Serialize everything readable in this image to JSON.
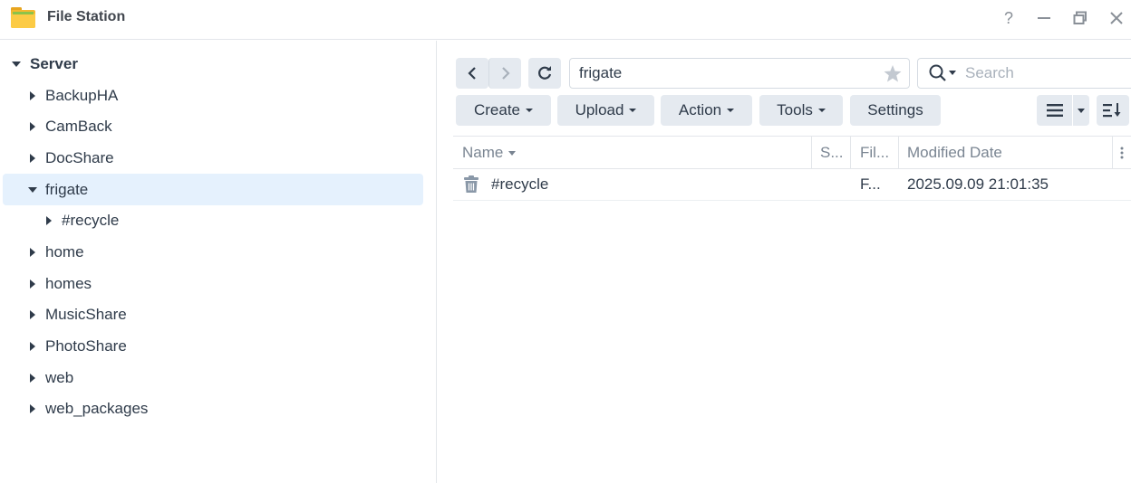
{
  "window": {
    "title": "File Station",
    "controls": {
      "help": "?",
      "minimize": "—",
      "restore": "restore",
      "close": "✕"
    }
  },
  "sidebar": {
    "root": "Server",
    "items": [
      {
        "label": "BackupHA",
        "expanded": false
      },
      {
        "label": "CamBack",
        "expanded": false
      },
      {
        "label": "DocShare",
        "expanded": false
      },
      {
        "label": "frigate",
        "expanded": true,
        "selected": true
      },
      {
        "label": "#recycle",
        "expanded": false,
        "child": true
      },
      {
        "label": "home",
        "expanded": false
      },
      {
        "label": "homes",
        "expanded": false
      },
      {
        "label": "MusicShare",
        "expanded": false
      },
      {
        "label": "PhotoShare",
        "expanded": false
      },
      {
        "label": "web",
        "expanded": false
      },
      {
        "label": "web_packages",
        "expanded": false
      }
    ]
  },
  "toolbar": {
    "path": "frigate",
    "search_placeholder": "Search",
    "buttons": {
      "create": "Create",
      "upload": "Upload",
      "action": "Action",
      "tools": "Tools",
      "settings": "Settings"
    }
  },
  "table": {
    "columns": {
      "name": "Name",
      "size": "S...",
      "type": "Fil...",
      "modified": "Modified Date"
    },
    "rows": [
      {
        "name": "#recycle",
        "type": "F...",
        "modified": "2025.09.09 21:01:35",
        "icon": "trash-icon"
      }
    ]
  },
  "colors": {
    "accent": "#e5f1fd",
    "button_bg": "#e5eaf0",
    "text": "#2f3b4a",
    "muted": "#7a8592"
  }
}
